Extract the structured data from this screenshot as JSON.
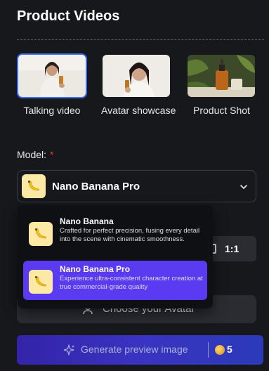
{
  "header": {
    "title": "Product Videos"
  },
  "templates": [
    {
      "label": "Talking video",
      "selected": true
    },
    {
      "label": "Avatar showcase",
      "selected": false
    },
    {
      "label": "Product Shot",
      "selected": false
    }
  ],
  "model": {
    "label": "Model:",
    "required_mark": "*",
    "selected_value": "Nano Banana Pro",
    "options": [
      {
        "name": "Nano Banana",
        "description": "Crafted for perfect precision, fusing every detail into the scene with cinematic smoothness.",
        "selected": false
      },
      {
        "name": "Nano Banana Pro",
        "description": "Experience ultra-consistent character creation at true commercial-grade quality",
        "selected": true
      }
    ]
  },
  "aspect_ratio": {
    "value": "1:1"
  },
  "avatar": {
    "button_label": "Choose your Avatar"
  },
  "generate": {
    "label": "Generate preview image",
    "credit_cost": "5"
  },
  "colors": {
    "accent": "#3f6ff0",
    "selected_option": "#5a3bf2",
    "required": "#ef3a3a",
    "background": "#17181c"
  },
  "icons": {
    "badge": "banana-icon",
    "chevron": "chevron-down-icon",
    "ratio": "aspect-ratio-icon",
    "avatar": "user-icon",
    "generate": "sparkle-icon",
    "credit": "coin-icon"
  }
}
